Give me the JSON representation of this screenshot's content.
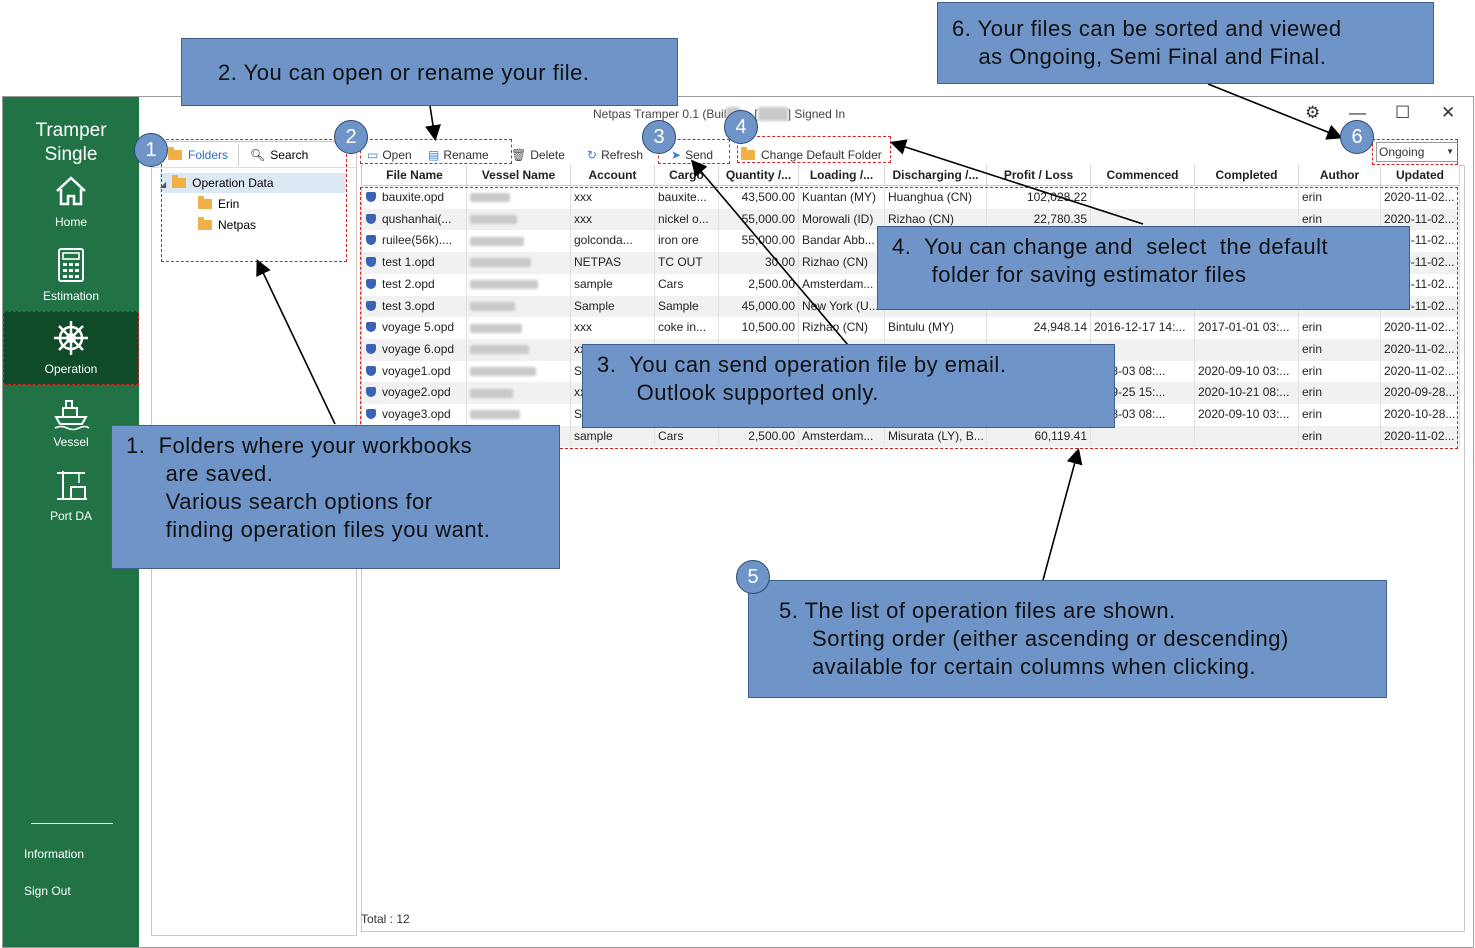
{
  "app": {
    "title_prefix": "Netpas Tramper 0.1 (Buil",
    "title_build": "12",
    "title_mid": ") - [",
    "title_user": "xxxxx",
    "title_suffix": "] Signed In",
    "brand_line1": "Tramper",
    "brand_line2": "Single"
  },
  "sidebar": {
    "items": [
      {
        "label": "Home",
        "icon": "home-icon"
      },
      {
        "label": "Estimation",
        "icon": "calculator-icon"
      },
      {
        "label": "Operation",
        "icon": "ship-wheel-icon",
        "active": true
      },
      {
        "label": "Vessel",
        "icon": "vessel-icon"
      },
      {
        "label": "Port DA",
        "icon": "port-crane-icon"
      }
    ],
    "information": "Information",
    "sign_out": "Sign Out"
  },
  "folders": {
    "tab_folders": "Folders",
    "tab_search": "Search",
    "root": "Operation Data",
    "children": [
      "Erin",
      "Netpas"
    ]
  },
  "toolbar": {
    "open": "Open",
    "rename": "Rename",
    "delete": "Delete",
    "refresh": "Refresh",
    "send": "Send",
    "change_folder": "Change Default Folder",
    "view_selected": "Ongoing"
  },
  "grid": {
    "columns": [
      "File Name",
      "Vessel Name",
      "Account",
      "Cargo",
      "Quantity /...",
      "Loading /...",
      "Discharging /...",
      "Profit / Loss",
      "Commenced",
      "Completed",
      "Author",
      "Updated"
    ],
    "rows": [
      [
        "bauxite.opd",
        "",
        "xxx",
        "bauxite...",
        "43,500.00",
        "Kuantan (MY)",
        "Huanghua (CN)",
        "102,028.22",
        "",
        "",
        "erin",
        "2020-11-02..."
      ],
      [
        "qushanhai(...",
        "",
        "xxx",
        "nickel o...",
        "55,000.00",
        "Morowali (ID)",
        "Rizhao (CN)",
        "22,780.35",
        "",
        "",
        "erin",
        "2020-11-02..."
      ],
      [
        "ruilee(56k)....",
        "",
        "golconda...",
        "iron ore",
        "55,000.00",
        "Bandar Abb...",
        "",
        "",
        "",
        "",
        "",
        "2020-11-02..."
      ],
      [
        "test 1.opd",
        "",
        "NETPAS",
        "TC OUT",
        "30.00",
        "Rizhao (CN)",
        "",
        "",
        "",
        "",
        "",
        "2020-11-02..."
      ],
      [
        "test 2.opd",
        "",
        "sample",
        "Cars",
        "2,500.00",
        "Amsterdam...",
        "",
        "",
        "",
        "",
        "",
        "2020-11-02..."
      ],
      [
        "test 3.opd",
        "",
        "Sample",
        "Sample",
        "45,000.00",
        "New York (U...",
        "",
        "",
        "",
        "",
        "",
        "2020-11-02..."
      ],
      [
        "voyage 5.opd",
        "",
        "xxx",
        "coke in...",
        "10,500.00",
        "Rizhao (CN)",
        "Bintulu (MY)",
        "24,948.14",
        "2016-12-17 14:...",
        "2017-01-01 03:...",
        "erin",
        "2020-11-02..."
      ],
      [
        "voyage 6.opd",
        "",
        "xx",
        "",
        "",
        "",
        "",
        "",
        "",
        "",
        "erin",
        "2020-11-02..."
      ],
      [
        "voyage1.opd",
        "",
        "Sa",
        "",
        "",
        "",
        "",
        "",
        "0-08-03 08:...",
        "2020-09-10 03:...",
        "erin",
        "2020-11-02..."
      ],
      [
        "voyage2.opd",
        "",
        "xx",
        "",
        "",
        "",
        "",
        "",
        "0-09-25 15:...",
        "2020-10-21 08:...",
        "erin",
        "2020-09-28..."
      ],
      [
        "voyage3.opd",
        "",
        "Sa",
        "",
        "",
        "",
        "",
        "",
        "0-08-03 08:...",
        "2020-09-10 03:...",
        "erin",
        "2020-10-28..."
      ],
      [
        "",
        "",
        "sample",
        "Cars",
        "2,500.00",
        "Amsterdam...",
        "Misurata (LY), B...",
        "60,119.41",
        "",
        "",
        "erin",
        "2020-11-02..."
      ]
    ],
    "total": "Total : 12"
  },
  "callouts": {
    "c1": "1.  Folders where your workbooks\n      are saved.\n      Various search options for\n      finding operation files you want.",
    "c2": "2. You can open or rename your file.",
    "c3": "3.  You can send operation file by email.\n      Outlook supported only.",
    "c4": "4.  You can change and  select  the default\n      folder for saving estimator files",
    "c5": "5. The list of operation files are shown.\n     Sorting order (either ascending or descending)\n     available for certain columns when clicking.",
    "c6": "6. Your files can be sorted and viewed\n    as Ongoing, Semi Final and Final."
  },
  "badges": [
    "1",
    "2",
    "3",
    "4",
    "5",
    "6"
  ],
  "colors": {
    "sidebar": "#217346",
    "sidebar_active": "#0f4a29",
    "callout": "#6f94c8",
    "highlight": "#d92020"
  }
}
